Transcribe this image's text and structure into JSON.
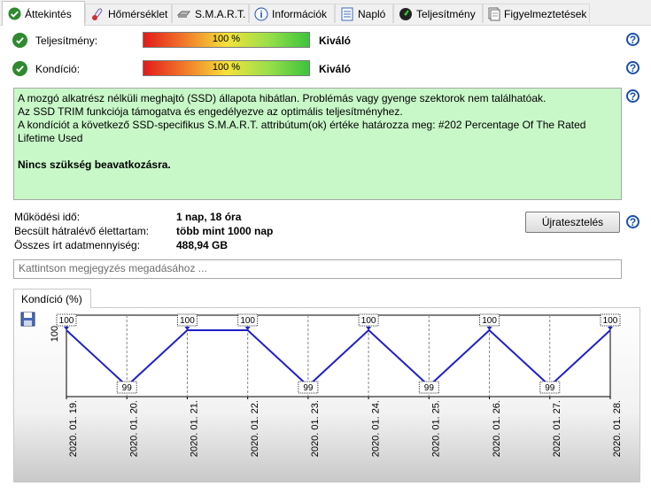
{
  "tabs": [
    {
      "label": "Áttekintés",
      "icon": "check-circle-icon",
      "active": true
    },
    {
      "label": "Hőmérséklet",
      "icon": "thermometer-icon"
    },
    {
      "label": "S.M.A.R.T.",
      "icon": "drive-icon"
    },
    {
      "label": "Információk",
      "icon": "info-icon"
    },
    {
      "label": "Napló",
      "icon": "document-icon"
    },
    {
      "label": "Teljesítmény",
      "icon": "gauge-icon"
    },
    {
      "label": "Figyelmeztetések",
      "icon": "warning-doc-icon"
    }
  ],
  "performance": {
    "label": "Teljesítmény:",
    "value_text": "100 %",
    "value": 100,
    "status": "Kiváló"
  },
  "condition": {
    "label": "Kondíció:",
    "value_text": "100 %",
    "value": 100,
    "status": "Kiváló"
  },
  "info": {
    "line1": "A mozgó alkatrész nélküli meghajtó (SSD) állapota hibátlan. Problémás vagy gyenge szektorok nem találhatóak.",
    "line2": "Az SSD TRIM funkciója támogatva és engedélyezve az optimális teljesítményhez.",
    "line3": "A kondíciót a következő SSD-specifikus S.M.A.R.T. attribútum(ok) értéke határozza meg:  #202 Percentage Of The Rated Lifetime Used",
    "action": "Nincs szükség beavatkozásra."
  },
  "stats": {
    "uptime_label": "Működési idő:",
    "uptime_value": "1 nap, 18 óra",
    "remaining_label": "Becsült hátralévő élettartam:",
    "remaining_value": "több mint 1000 nap",
    "written_label": "Összes írt adatmennyiség:",
    "written_value": "488,94 GB"
  },
  "retest_label": "Újratesztelés",
  "note_placeholder": "Kattintson megjegyzés megadásához ...",
  "chart_tab_label": "Kondíció  (%)",
  "colors": {
    "line": "#2020c8",
    "info_bg": "#c8f7c8",
    "ok_green": "#2f8a2f",
    "help_blue": "#1a4fb0"
  },
  "chart_data": {
    "type": "line",
    "ylabel": "100",
    "categories": [
      "2020. 01. 19.",
      "2020. 01. 20.",
      "2020. 01. 21.",
      "2020. 01. 22.",
      "2020. 01. 23.",
      "2020. 01. 24.",
      "2020. 01. 25.",
      "2020. 01. 26.",
      "2020. 01. 27.",
      "2020. 01. 28."
    ],
    "values": [
      100,
      99,
      100,
      100,
      99,
      100,
      99,
      100,
      99,
      100
    ],
    "ylim": [
      99,
      100
    ],
    "grid": true
  }
}
